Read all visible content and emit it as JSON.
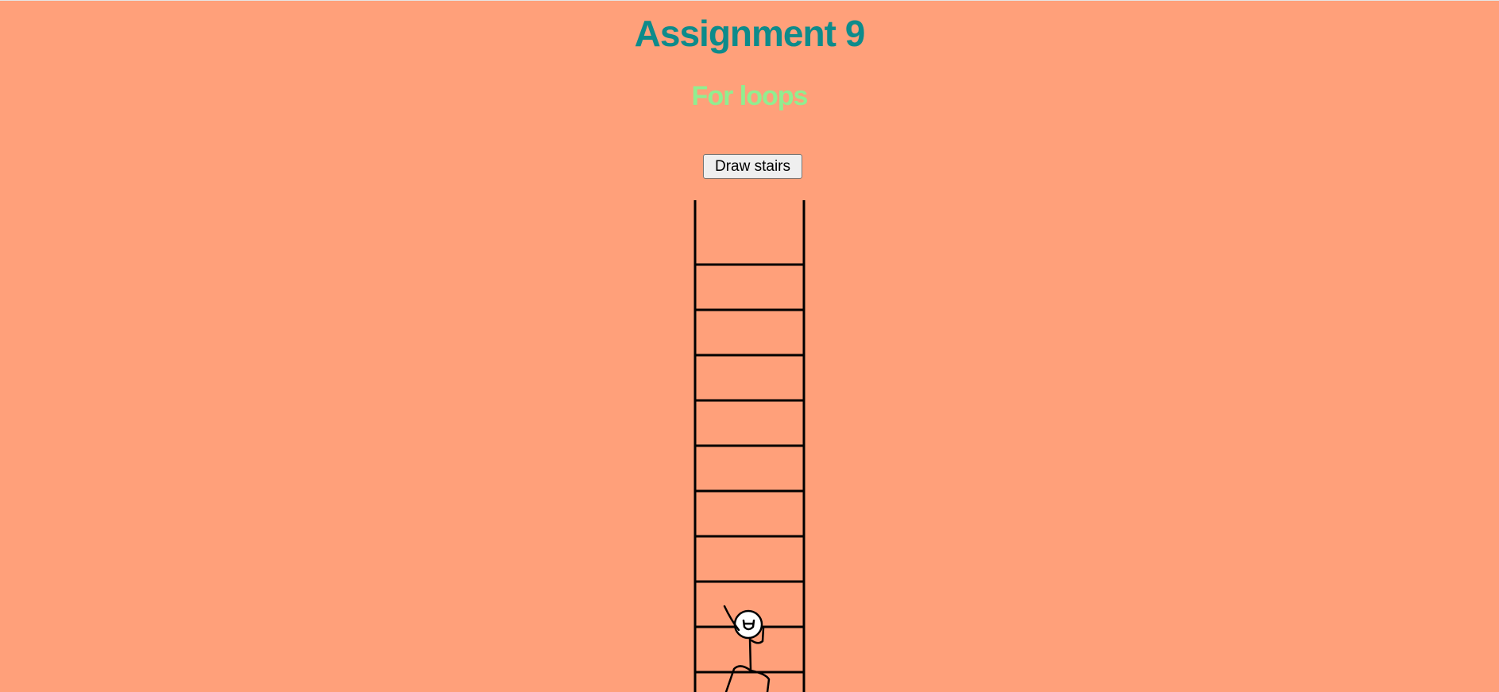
{
  "page": {
    "title": "Assignment 9",
    "subtitle": "For loops",
    "background": "#ffa07a",
    "title_color": "#0d8b8b",
    "subtitle_color": "#90ee90"
  },
  "toolbar": {
    "draw_label": "Draw stairs"
  },
  "drawing": {
    "ladder_rungs": 10,
    "figure": "stick-figure-climbing"
  }
}
